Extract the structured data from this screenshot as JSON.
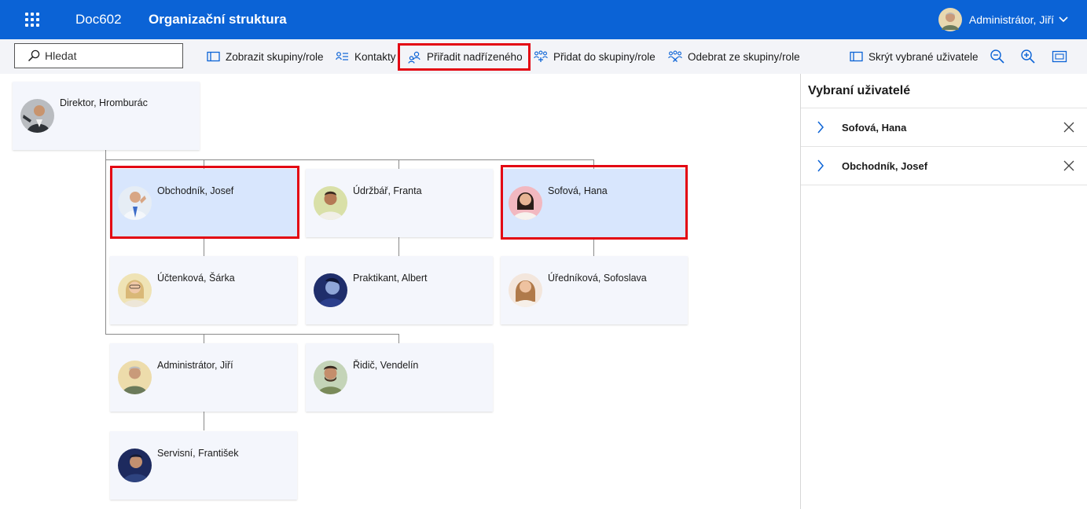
{
  "header": {
    "app_name": "Doc602",
    "page_title": "Organizační struktura",
    "user_name": "Administrátor, Jiří",
    "color": "#0b63d6"
  },
  "toolbar": {
    "search_placeholder": "Hledat",
    "show_groups": "Zobrazit skupiny/role",
    "contacts": "Kontakty",
    "assign_superior": "Přiřadit nadřízeného",
    "add_to_group": "Přidat do skupiny/role",
    "remove_from_group": "Odebrat ze skupiny/role",
    "hide_selected": "Skrýt vybrané uživatele",
    "zoom_out_icon": "zoom-out-icon",
    "zoom_in_icon": "zoom-in-icon",
    "fit_icon": "fit-screen-icon"
  },
  "org": {
    "director": "Direktor, Hromburác",
    "obchodnik": "Obchodník, Josef",
    "udrzbar": "Údržbář, Franta",
    "sofova": "Sofová, Hana",
    "uctenkova": "Účtenková, Šárka",
    "praktikant": "Praktikant, Albert",
    "urednikova": "Úředníková, Sofoslava",
    "administrator": "Administrátor, Jiří",
    "ridic": "Řidič, Vendelín",
    "servisni": "Servisní, František"
  },
  "panel": {
    "title": "Vybraní uživatelé",
    "items": [
      {
        "name": "Sofová, Hana"
      },
      {
        "name": "Obchodník, Josef"
      }
    ]
  },
  "colors": {
    "accent": "#0b63d6",
    "card": "#f4f6fc",
    "card_selected": "#d8e6fd",
    "highlight": "#e30613"
  }
}
